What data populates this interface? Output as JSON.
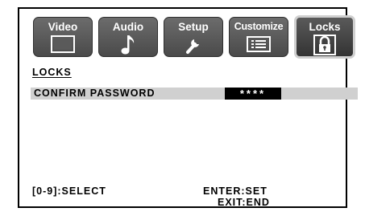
{
  "tabs": [
    {
      "label": "Video",
      "icon": "monitor-icon",
      "active": false
    },
    {
      "label": "Audio",
      "icon": "music-note-icon",
      "active": false
    },
    {
      "label": "Setup",
      "icon": "wrench-icon",
      "active": false
    },
    {
      "label": "Customize",
      "icon": "list-icon",
      "active": false
    },
    {
      "label": "Locks",
      "icon": "padlock-icon",
      "active": true
    }
  ],
  "section_title": "LOCKS",
  "confirm_row": {
    "label": "CONFIRM PASSWORD",
    "value": "****"
  },
  "footer": {
    "select_hint": "[0-9]:SELECT",
    "enter_hint": "ENTER:SET",
    "exit_hint": "EXIT:END"
  }
}
